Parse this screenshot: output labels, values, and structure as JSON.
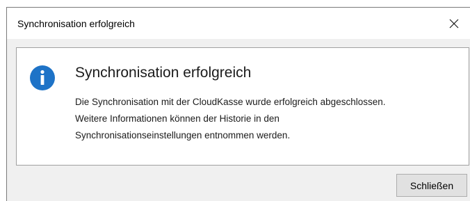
{
  "window": {
    "title": "Synchronisation erfolgreich"
  },
  "dialog": {
    "icon": "info-icon",
    "heading": "Synchronisation erfolgreich",
    "message_lines": [
      "Die Synchronisation mit der CloudKasse wurde erfolgreich abgeschlossen.",
      "Weitere Informationen können der Historie in den",
      "Synchronisationseinstellungen entnommen werden."
    ]
  },
  "buttons": {
    "close_label": "Schließen"
  },
  "colors": {
    "info_icon": "#1e73c7",
    "window_bg": "#f0f0f0",
    "panel_bg": "#ffffff"
  }
}
